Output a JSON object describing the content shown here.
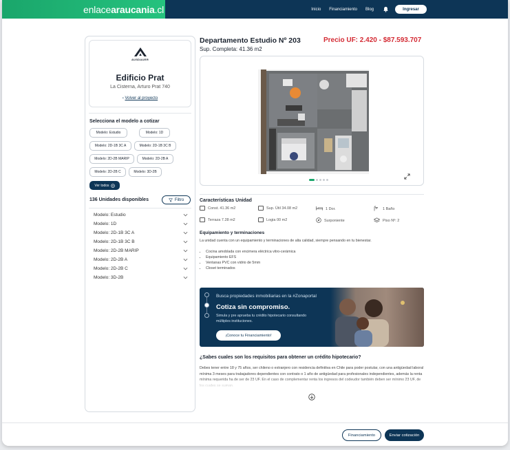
{
  "header": {
    "logo_light": "enlace",
    "logo_bold": "araucania",
    "logo_suffix": ".cl",
    "nav": [
      "Inicio",
      "Financiamiento",
      "Blog"
    ],
    "login_label": "Ingresar"
  },
  "project": {
    "brand": "AUSDAUER",
    "building": "Edificio Prat",
    "address": "La Cisterna, Arturo Prat 740",
    "back_label": "Volver al proyecto"
  },
  "models_section": {
    "title": "Selecciona el modelo a cotizar",
    "chips": [
      "Modelo: Estudio",
      "Modelo: 1D",
      "Modelo: 2D-1B 3C A",
      "Modelo: 2D-1B 3C B",
      "Modelo: 2D-2B MARIP",
      "Modelo: 2D-2B A",
      "Modelo: 2D-2B C",
      "Modelo: 3D-2B"
    ],
    "see_all": "Ver todos"
  },
  "units": {
    "count_label": "136 Unidades disponibles",
    "filter_label": "Filtro",
    "rows": [
      "Modelo: Estudio",
      "Modelo: 1D",
      "Modelo: 2D-1B 3C A",
      "Modelo: 2D-1B 3C B",
      "Modelo: 2D-2B MARIP",
      "Modelo: 2D-2B A",
      "Modelo: 2D-2B C",
      "Modelo: 3D-2B"
    ]
  },
  "unit": {
    "title": "Departamento  Estudio Nº 203",
    "price": "Precio UF: 2.420 - $87.593.707",
    "surface": "Sup. Completa: 41.36 m2"
  },
  "gallery": {
    "slide_count": 5,
    "active_slide": 1
  },
  "characteristics": {
    "title": "Características Unidad",
    "items": [
      "Const. 41.36 m2",
      "Sup. Útil 34.08 m2",
      "1 Dor.",
      "1 Baño",
      "Terraza 7.28 m2",
      "Logia 00 m2",
      "Surponiente",
      "Piso Nº: 2"
    ]
  },
  "equipment": {
    "title": "Equipamiento y terminaciones",
    "description": "La unidad cuenta con un equipamiento y terminaciones de alta calidad, siempre pensando en tu bienestar.",
    "items": [
      "Cocina amoblada con encimera eléctrica vitro-cerámica",
      "Equipamiento EFS",
      "Ventanas PVC con vidrio de 5mm",
      "Closet terminados"
    ]
  },
  "banner": {
    "line1": "Busca propiedades inmobiliarias en la #Zonaportal",
    "headline": "Cotiza sin compromiso.",
    "body": "Simula y pre aprueba tu crédito hipotecario consultando múltiples instituciones.",
    "cta": "¡Conoce tu Financiamiento!"
  },
  "faq": {
    "title": "¿Sabes cuales son los requisitos para obtener un crédito hipotecario?",
    "text": "Debes tener entre 18 y 75 años, ser chileno o extranjero con residencia definitiva en Chile para poder postular, con una antigüedad laboral mínima 3 meses para trabajadores dependientes con contrato o 1 año de antigüedad para profesionales independientes, además la renta mínima requerida ha de ser de 23 UF. En el caso de complementar renta los ingresos del codeudor también deben ser mínimo 23 UF, de los cuales se suman."
  },
  "footer": {
    "financing_label": "Financiamiento",
    "send_label": "Enviar cotización"
  }
}
